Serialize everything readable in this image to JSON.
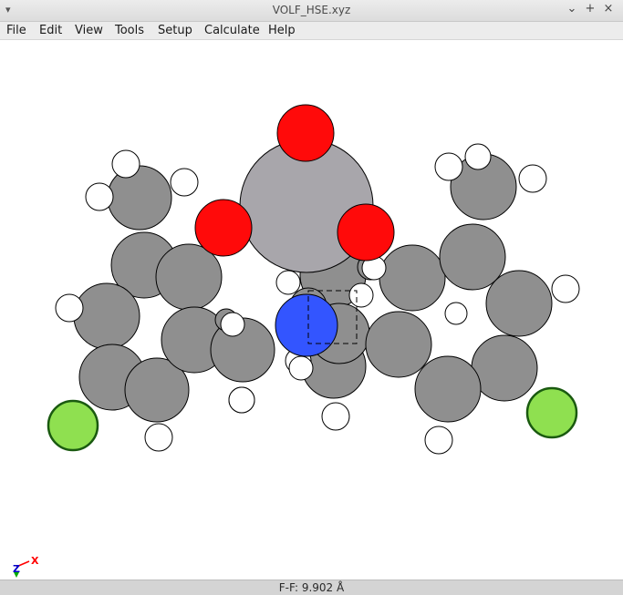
{
  "window": {
    "title": "VOLF_HSE.xyz",
    "menu_button_glyph": "▾",
    "minimize_glyph": "⌄",
    "maximize_glyph": "+",
    "close_glyph": "×"
  },
  "menubar": {
    "items": [
      "File",
      "Edit",
      "View",
      "Tools",
      "Setup",
      "Calculate",
      "Help"
    ]
  },
  "status": {
    "text": "F-F: 9.902 Å"
  },
  "axis_indicator": {
    "x_label": "X",
    "z_label": "Z"
  },
  "colors": {
    "carbon": "#8f8f8f",
    "hydrogen": "#ffffff",
    "oxygen": "#ff0a0a",
    "nitrogen": "#3355ff",
    "fluorine": "#8fe050",
    "fluorine_outline": "#1a5a10",
    "metal": "#a8a6ab",
    "axis_x": "#ff0000",
    "axis_z": "#0000cc",
    "axis_y": "#00aa00"
  },
  "molecule": {
    "elements": [
      "C",
      "C",
      "C",
      "C",
      "C",
      "C",
      "C",
      "C",
      "C",
      "C",
      "C",
      "C",
      "C",
      "C",
      "C",
      "C",
      "C",
      "C",
      "C",
      "C",
      "C",
      "C",
      "H",
      "H",
      "H",
      "H",
      "H",
      "H",
      "H",
      "H",
      "H",
      "H",
      "H",
      "H",
      "H",
      "H",
      "H",
      "H",
      "H",
      "H",
      "H",
      "Metal",
      "O",
      "O",
      "O",
      "N",
      "F",
      "F"
    ]
  }
}
